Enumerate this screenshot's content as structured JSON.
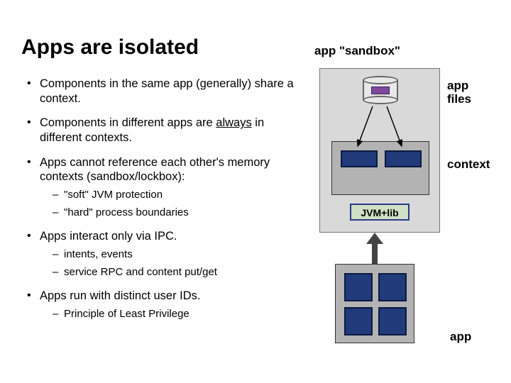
{
  "title": "Apps are isolated",
  "bullets": [
    {
      "text": "Components in the same app (generally) share a context."
    },
    {
      "text_pre": "Components in different apps are ",
      "u": "always",
      "text_post": " in different contexts."
    },
    {
      "text": "Apps cannot reference each other's memory contexts (sandbox/lockbox):",
      "sub": [
        "\"soft\" JVM protection",
        "\"hard\" process boundaries"
      ]
    },
    {
      "text": "Apps interact only via IPC.",
      "sub": [
        "intents, events",
        "service RPC and content put/get"
      ]
    },
    {
      "text": "Apps run with distinct user IDs.",
      "sub": [
        "Principle of Least Privilege"
      ]
    }
  ],
  "labels": {
    "sandbox": "app \"sandbox\"",
    "appfiles": "app\nfiles",
    "context": "context",
    "app": "app",
    "jvm": "JVM+lib"
  }
}
